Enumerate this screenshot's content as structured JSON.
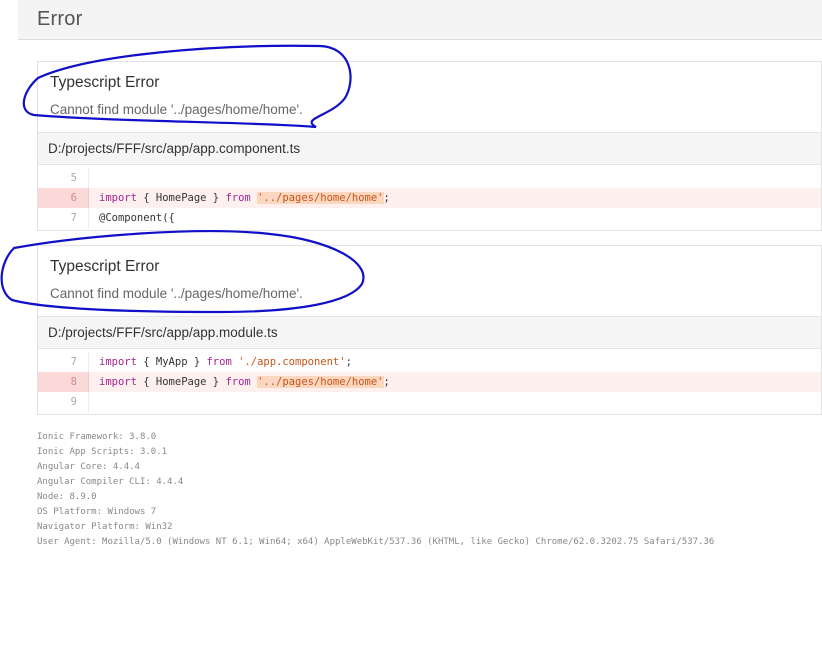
{
  "header": {
    "title": "Error"
  },
  "errors": [
    {
      "title": "Typescript Error",
      "message": "Cannot find module '../pages/home/home'.",
      "file": "D:/projects/FFF/src/app/app.component.ts",
      "lines": [
        {
          "num": "5",
          "highlight": false,
          "tokens": []
        },
        {
          "num": "6",
          "highlight": true,
          "tokens": [
            {
              "t": "import",
              "c": "kw"
            },
            {
              "t": " { HomePage } ",
              "c": ""
            },
            {
              "t": "from",
              "c": "kw"
            },
            {
              "t": " ",
              "c": ""
            },
            {
              "t": "'../pages/home/home'",
              "c": "str err"
            },
            {
              "t": ";",
              "c": ""
            }
          ]
        },
        {
          "num": "7",
          "highlight": false,
          "tokens": [
            {
              "t": "@Component({",
              "c": ""
            }
          ]
        }
      ]
    },
    {
      "title": "Typescript Error",
      "message": "Cannot find module '../pages/home/home'.",
      "file": "D:/projects/FFF/src/app/app.module.ts",
      "lines": [
        {
          "num": "7",
          "highlight": false,
          "tokens": [
            {
              "t": "import",
              "c": "kw"
            },
            {
              "t": " { MyApp } ",
              "c": ""
            },
            {
              "t": "from",
              "c": "kw"
            },
            {
              "t": " ",
              "c": ""
            },
            {
              "t": "'./app.component'",
              "c": "str"
            },
            {
              "t": ";",
              "c": ""
            }
          ]
        },
        {
          "num": "8",
          "highlight": true,
          "tokens": [
            {
              "t": "import",
              "c": "kw"
            },
            {
              "t": " { HomePage } ",
              "c": ""
            },
            {
              "t": "from",
              "c": "kw"
            },
            {
              "t": " ",
              "c": ""
            },
            {
              "t": "'../pages/home/home'",
              "c": "str err"
            },
            {
              "t": ";",
              "c": ""
            }
          ]
        },
        {
          "num": "9",
          "highlight": false,
          "tokens": []
        }
      ]
    }
  ],
  "environment": [
    "Ionic Framework: 3.8.0",
    "Ionic App Scripts: 3.0.1",
    "Angular Core: 4.4.4",
    "Angular Compiler CLI: 4.4.4",
    "Node: 8.9.0",
    "OS Platform: Windows 7",
    "Navigator Platform: Win32",
    "User Agent: Mozilla/5.0 (Windows NT 6.1; Win64; x64) AppleWebKit/537.36 (KHTML, like Gecko) Chrome/62.0.3202.75 Safari/537.36"
  ],
  "colors": {
    "annotation": "#1010c8",
    "highlight_row": "#fff0f0",
    "keyword": "#a0268f",
    "string": "#c8551a"
  }
}
